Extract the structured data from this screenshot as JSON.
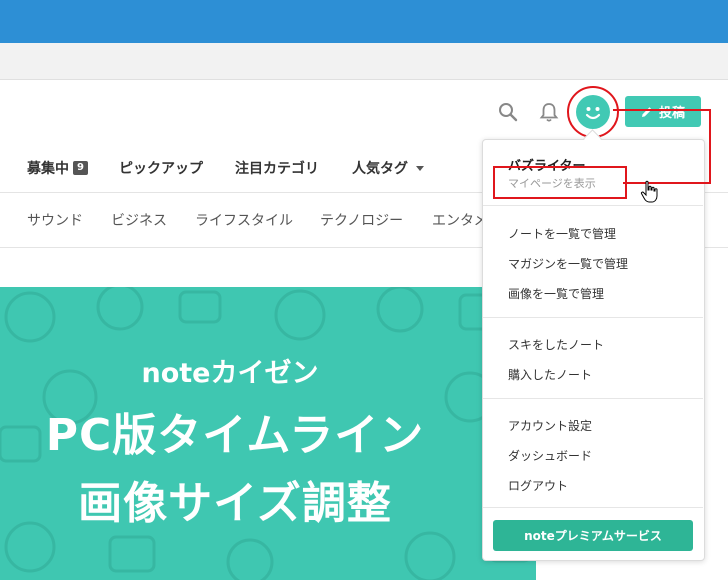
{
  "header": {
    "post_label": "投稿",
    "icons": [
      "search-icon",
      "bell-icon",
      "user-avatar-smile",
      "pencil-icon"
    ]
  },
  "nav": {
    "items": [
      {
        "label": "募集中",
        "badge": "9"
      },
      {
        "label": "ピックアップ"
      },
      {
        "label": "注目カテゴリ"
      },
      {
        "label": "人気タグ"
      }
    ]
  },
  "categories": [
    "サウンド",
    "ビジネス",
    "ライフスタイル",
    "テクノロジー",
    "エンタメ"
  ],
  "banner": {
    "subtitle": "noteカイゼン",
    "title_line1": "PC版タイムライン",
    "title_line2": "画像サイズ調整"
  },
  "dropdown": {
    "username": "バズライター",
    "mypage_label": "マイページを表示",
    "group1": [
      "ノートを一覧で管理",
      "マガジンを一覧で管理",
      "画像を一覧で管理"
    ],
    "group2": [
      "スキをしたノート",
      "購入したノート"
    ],
    "group3": [
      "アカウント設定",
      "ダッシュボード",
      "ログアウト"
    ],
    "premium_label": "noteプレミアムサービス"
  },
  "colors": {
    "browser_bar": "#2d8fd5",
    "accent": "#41c9b4",
    "banner": "#3fc7b1",
    "premium": "#2eb596",
    "annotation": "#e0161c"
  }
}
